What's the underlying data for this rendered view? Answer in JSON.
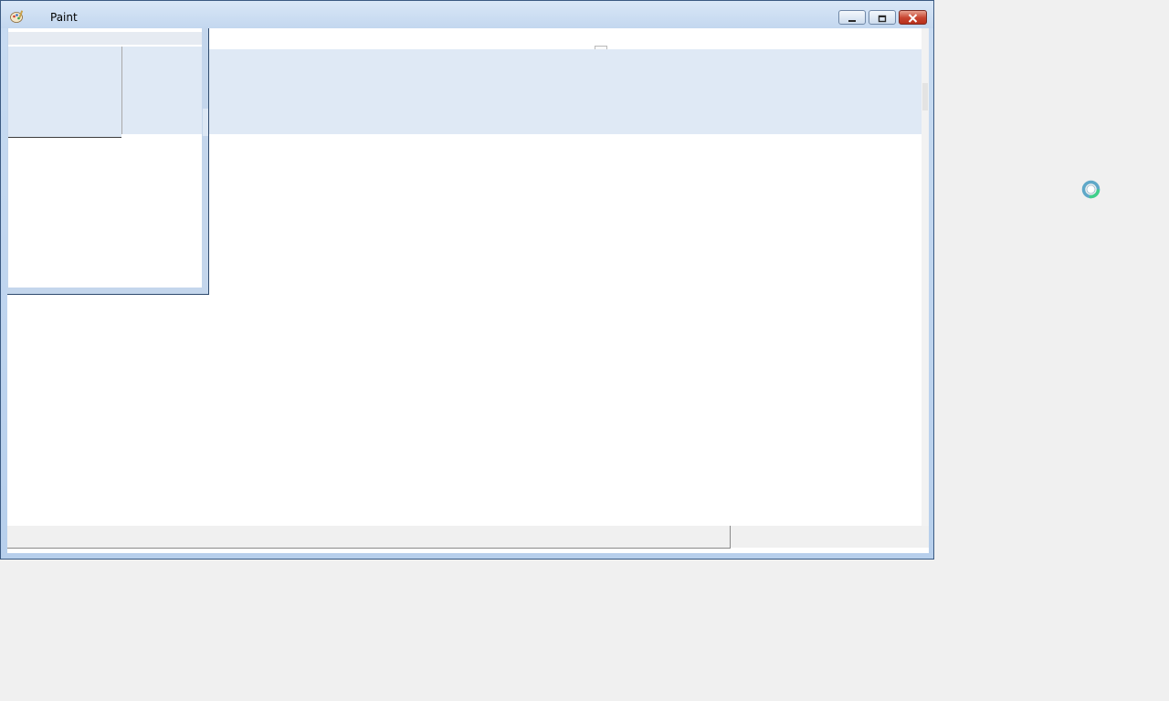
{
  "window": {
    "title": "Paint",
    "app_icon": "paint-app-icon",
    "controls": {
      "minimize_icon": "minimize-icon",
      "maximize_icon": "maximize-icon",
      "close_icon": "close-icon"
    }
  },
  "cursor": {
    "icon": "busy-spinner-icon"
  },
  "colors": {
    "titlebar": "#c3d7ef",
    "ribbon": "#dfe9f5",
    "close_button": "#c7432f",
    "desktop": "#f0f0f0"
  }
}
